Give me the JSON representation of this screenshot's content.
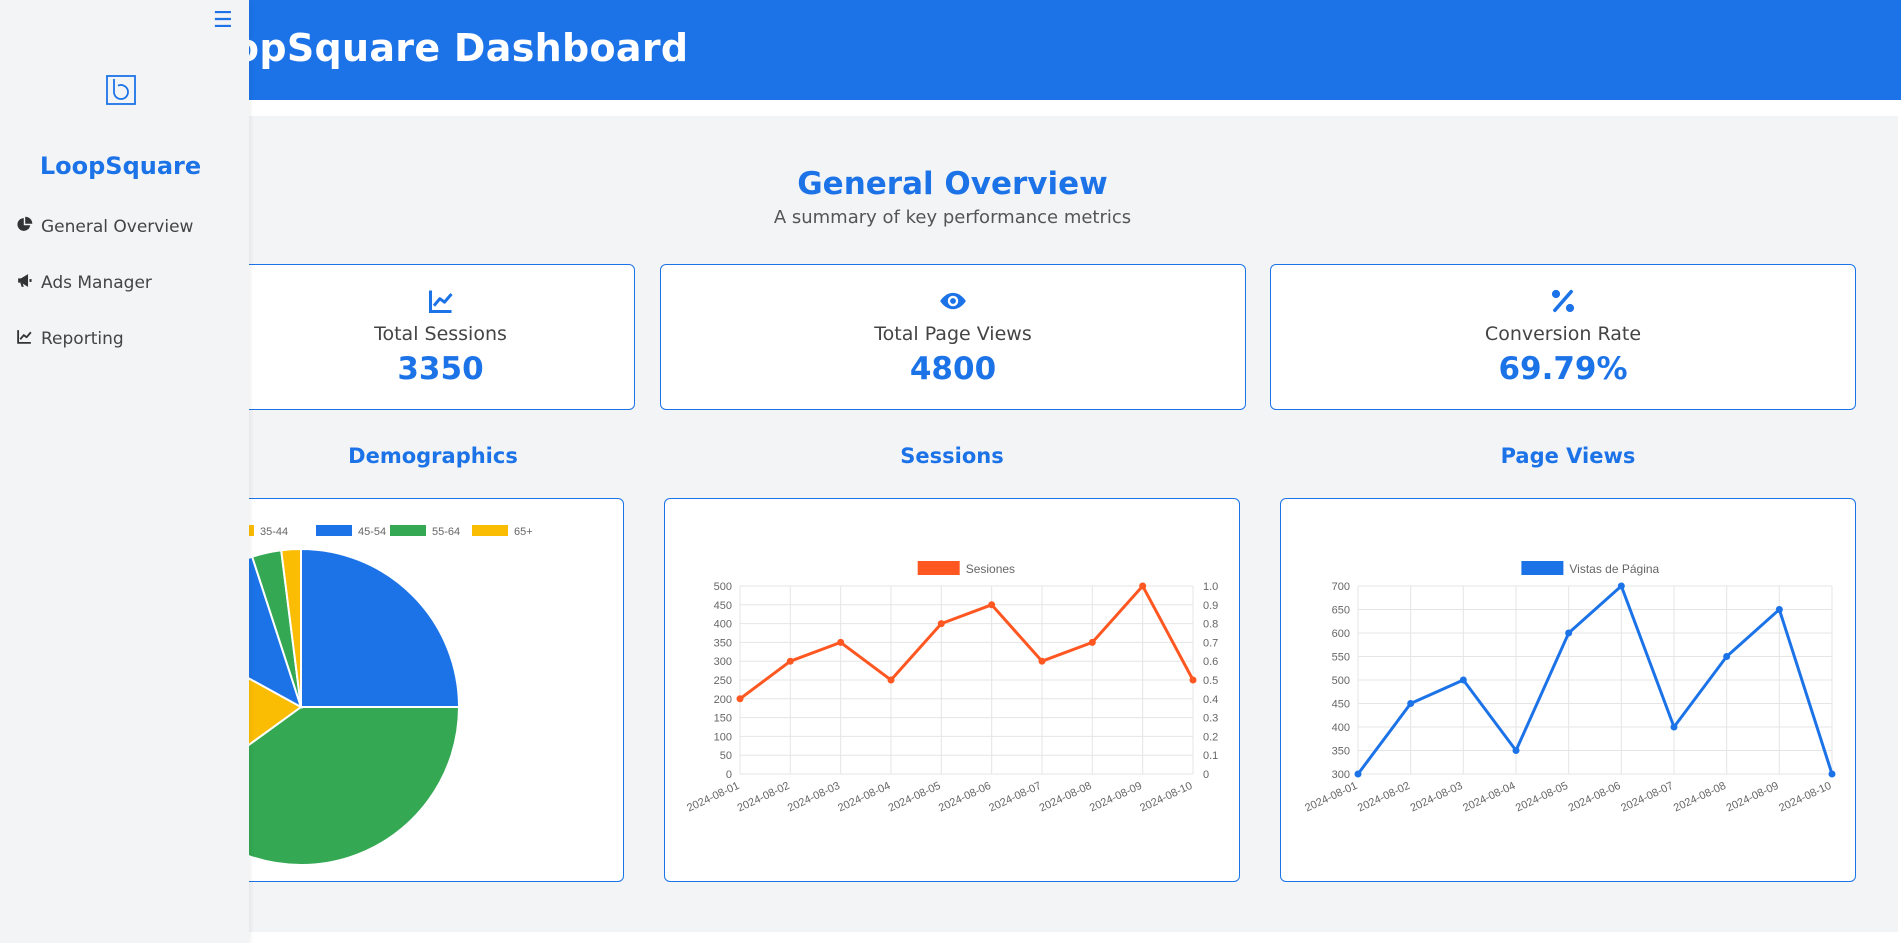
{
  "header": {
    "title": "LoopSquare Dashboard"
  },
  "sidebar": {
    "brand": "LoopSquare",
    "items": [
      {
        "label": "General Overview",
        "icon": "pie-chart-icon"
      },
      {
        "label": "Ads Manager",
        "icon": "megaphone-icon"
      },
      {
        "label": "Reporting",
        "icon": "line-chart-icon"
      }
    ]
  },
  "overview": {
    "title": "General Overview",
    "subtitle": "A summary of key performance metrics"
  },
  "metrics": [
    {
      "label": "Total Sessions",
      "value": "3350",
      "icon": "trend-chart-icon"
    },
    {
      "label": "Total Page Views",
      "value": "4800",
      "icon": "eye-icon"
    },
    {
      "label": "Conversion Rate",
      "value": "69.79%",
      "icon": "percent-icon"
    }
  ],
  "charts": {
    "demographics_title": "Demographics",
    "sessions_title": "Sessions",
    "pageviews_title": "Page Views"
  },
  "colors": {
    "primary": "#1c73e8",
    "sessions_line": "#ff5722",
    "pie": [
      "#1c73e8",
      "#34a853",
      "#fbbc04"
    ]
  },
  "chart_data": [
    {
      "type": "pie",
      "legend_visible": [
        "35-44",
        "45-54",
        "55-64",
        "65+"
      ],
      "legend_colors": [
        "#fbbc04",
        "#1c73e8",
        "#34a853",
        "#fbbc04"
      ],
      "slices": [
        {
          "label": "?",
          "value": 25,
          "color": "#1c73e8"
        },
        {
          "label": "?",
          "value": 40,
          "color": "#34a853"
        },
        {
          "label": "?",
          "value": 18,
          "color": "#fbbc04"
        },
        {
          "label": "45-54",
          "value": 12,
          "color": "#1c73e8"
        },
        {
          "label": "55-64",
          "value": 3,
          "color": "#34a853"
        },
        {
          "label": "65+",
          "value": 2,
          "color": "#fbbc04"
        }
      ],
      "legend_position": "top"
    },
    {
      "type": "line",
      "x": [
        "2024-08-01",
        "2024-08-02",
        "2024-08-03",
        "2024-08-04",
        "2024-08-05",
        "2024-08-06",
        "2024-08-07",
        "2024-08-08",
        "2024-08-09",
        "2024-08-10"
      ],
      "series": [
        {
          "name": "Sesiones",
          "values": [
            200,
            300,
            350,
            250,
            400,
            450,
            300,
            350,
            500,
            250
          ],
          "color": "#ff5722"
        }
      ],
      "ylim": [
        0,
        500
      ],
      "yticks": [
        "0",
        "50",
        "100",
        "150",
        "200",
        "250",
        "300",
        "350",
        "400",
        "450",
        "500"
      ],
      "y2ticks": [
        "0",
        "0.1",
        "0.2",
        "0.3",
        "0.4",
        "0.5",
        "0.6",
        "0.7",
        "0.8",
        "0.9",
        "1.0"
      ],
      "legend_position": "top",
      "grid": true
    },
    {
      "type": "line",
      "x": [
        "2024-08-01",
        "2024-08-02",
        "2024-08-03",
        "2024-08-04",
        "2024-08-05",
        "2024-08-06",
        "2024-08-07",
        "2024-08-08",
        "2024-08-09",
        "2024-08-10"
      ],
      "series": [
        {
          "name": "Vistas de Página",
          "values": [
            300,
            450,
            500,
            350,
            600,
            700,
            400,
            550,
            650,
            300
          ],
          "color": "#1c73e8"
        }
      ],
      "ylim": [
        300,
        700
      ],
      "yticks": [
        "300",
        "350",
        "400",
        "450",
        "500",
        "550",
        "600",
        "650",
        "700"
      ],
      "legend_position": "top",
      "grid": true
    }
  ]
}
